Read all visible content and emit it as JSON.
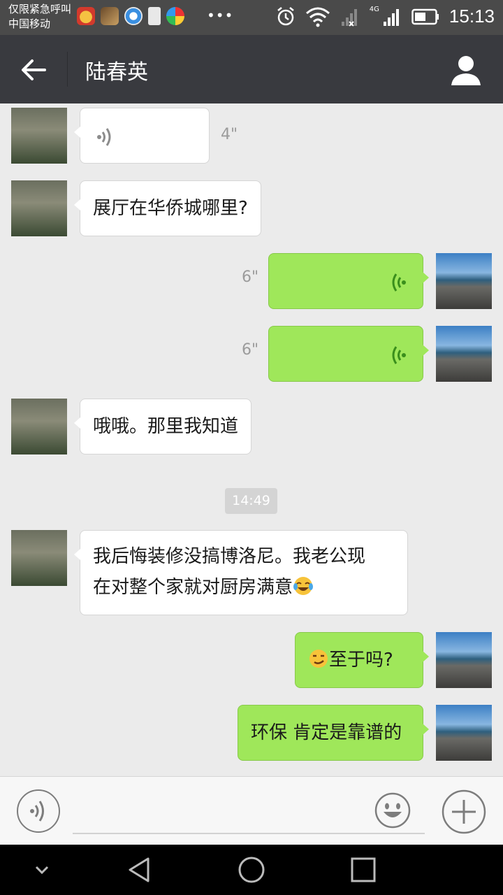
{
  "status_bar": {
    "carrier_line1": "仅限紧急呼叫",
    "carrier_line2": "中国移动",
    "more": "•••",
    "network": "4G",
    "time": "15:13"
  },
  "header": {
    "title": "陆春英"
  },
  "messages": [
    {
      "from": "them",
      "type": "voice",
      "duration": "4\""
    },
    {
      "from": "them",
      "type": "text",
      "text": "展厅在华侨城哪里?"
    },
    {
      "from": "me",
      "type": "voice",
      "duration": "6\""
    },
    {
      "from": "me",
      "type": "voice",
      "duration": "6\""
    },
    {
      "from": "them",
      "type": "text",
      "text": "哦哦。那里我知道"
    },
    {
      "from": "them",
      "type": "text",
      "text_line1": "我后悔装修没搞博洛尼。我老公现",
      "text_line2": "在对整个家就对厨房满意",
      "emoji": "tears-of-joy-emoji"
    },
    {
      "from": "me",
      "type": "text",
      "text": "至于吗?",
      "emoji": "smirk-emoji"
    },
    {
      "from": "me",
      "type": "text",
      "text": "环保 肯定是靠谱的"
    }
  ],
  "timestamp": "14:49",
  "colors": {
    "title_bar": "#393a3f",
    "outgoing_bubble": "#9fe75a",
    "incoming_bubble": "#ffffff",
    "chat_background": "#ebebeb",
    "voice_wave_out": "#3a8f1c"
  }
}
